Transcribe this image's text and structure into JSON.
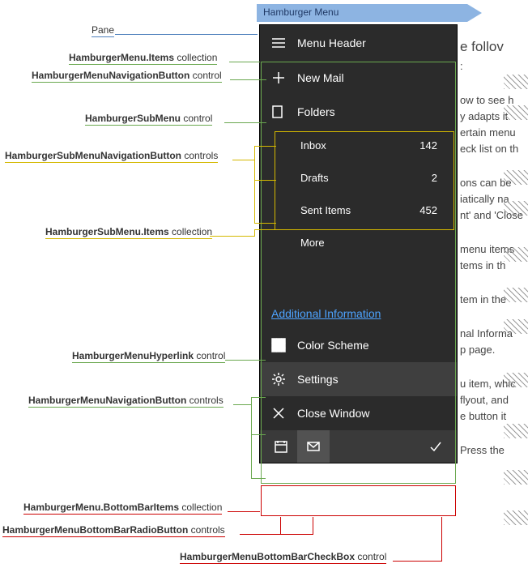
{
  "title": "Hamburger Menu",
  "labels": {
    "pane": "Pane",
    "items": "HamburgerMenu.Items",
    "items_suffix": " collection",
    "navbtn": "HamburgerMenuNavigationButton",
    "navbtn_suffix": " control",
    "submenu": "HamburgerSubMenu",
    "submenu_suffix": " control",
    "subnav": "HamburgerSubMenuNavigationButton",
    "subnav_suffix": " controls",
    "subitems": "HamburgerSubMenu.Items",
    "subitems_suffix": " collection",
    "hyperlink": "HamburgerMenuHyperlink",
    "hyperlink_suffix": " control",
    "navbtns": "HamburgerMenuNavigationButton",
    "navbtns_suffix": " controls",
    "bottombar": "HamburgerMenu.BottomBarItems",
    "bottombar_suffix": " collection",
    "bbradio": "HamburgerMenuBottomBarRadioButton",
    "bbradio_suffix": " controls",
    "bbcheck": "HamburgerMenuBottomBarCheckBox",
    "bbcheck_suffix": " control"
  },
  "menu": {
    "header": "Menu Header",
    "new_mail": "New Mail",
    "folders": "Folders",
    "sub": [
      {
        "label": "Inbox",
        "count": "142"
      },
      {
        "label": "Drafts",
        "count": "2"
      },
      {
        "label": "Sent Items",
        "count": "452"
      }
    ],
    "more": "More",
    "hyperlink": "Additional Information",
    "color_scheme": "Color Scheme",
    "settings": "Settings",
    "close": "Close Window"
  },
  "bgtext": {
    "l1": "e follov",
    "l2": ":",
    "l3": "ow to see h\ny adapts it\nertain menu\neck list on th",
    "l4": "ons can be\niatically na\nnt' and 'Close",
    "l5": "menu items\ntems in th",
    "l6": "tem in the",
    "l7": "nal Informa\np page.",
    "l8": "u item, whic\nflyout, and\ne button it",
    "l9": "Press the"
  }
}
